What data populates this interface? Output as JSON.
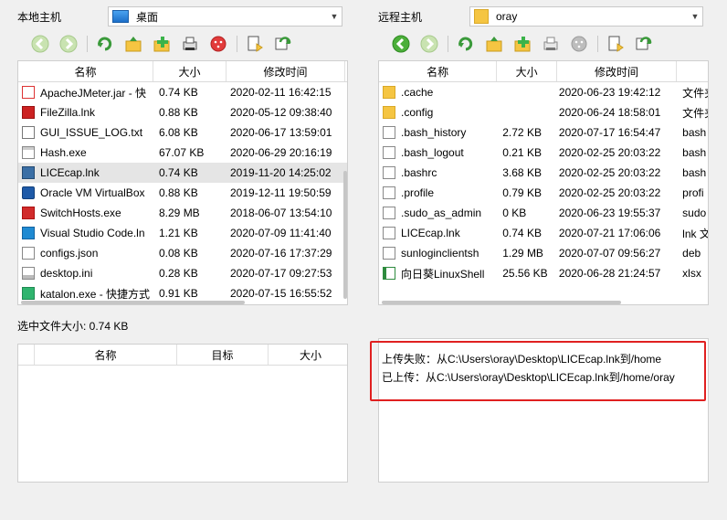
{
  "local": {
    "title": "本地主机",
    "path": "桌面",
    "headers": [
      "名称",
      "大小",
      "修改时间"
    ],
    "files": [
      {
        "name": "ApacheJMeter.jar - 快",
        "size": "0.74 KB",
        "time": "2020-02-11 16:42:15",
        "icon": "java-icon"
      },
      {
        "name": "FileZilla.lnk",
        "size": "0.88 KB",
        "time": "2020-05-12 09:38:40",
        "icon": "filezilla-icon"
      },
      {
        "name": "GUI_ISSUE_LOG.txt",
        "size": "6.08 KB",
        "time": "2020-06-17 13:59:01",
        "icon": "text-file-icon"
      },
      {
        "name": "Hash.exe",
        "size": "67.07 KB",
        "time": "2020-06-29 20:16:19",
        "icon": "exe-icon"
      },
      {
        "name": "LICEcap.lnk",
        "size": "0.74 KB",
        "time": "2019-11-20 14:25:02",
        "icon": "licecap-icon"
      },
      {
        "name": "Oracle VM VirtualBox",
        "size": "0.88 KB",
        "time": "2019-12-11 19:50:59",
        "icon": "virtualbox-icon"
      },
      {
        "name": "SwitchHosts.exe",
        "size": "8.29 MB",
        "time": "2018-06-07 13:54:10",
        "icon": "switchhosts-icon"
      },
      {
        "name": "Visual Studio Code.ln",
        "size": "1.21 KB",
        "time": "2020-07-09 11:41:40",
        "icon": "vscode-icon"
      },
      {
        "name": "configs.json",
        "size": "0.08 KB",
        "time": "2020-07-16 17:37:29",
        "icon": "file-icon"
      },
      {
        "name": "desktop.ini",
        "size": "0.28 KB",
        "time": "2020-07-17 09:27:53",
        "icon": "ini-file-icon"
      },
      {
        "name": "katalon.exe - 快捷方式",
        "size": "0.91 KB",
        "time": "2020-07-15 16:55:52",
        "icon": "katalon-icon"
      }
    ],
    "selected_size": "选中文件大小: 0.74 KB"
  },
  "remote": {
    "title": "远程主机",
    "path": "oray",
    "headers": [
      "名称",
      "大小",
      "修改时间",
      ""
    ],
    "files": [
      {
        "name": ".cache",
        "size": "",
        "time": "2020-06-23 19:42:12",
        "type": "文件夹",
        "icon": "folder-icon"
      },
      {
        "name": ".config",
        "size": "",
        "time": "2020-06-24 18:58:01",
        "type": "文件夹",
        "icon": "folder-icon"
      },
      {
        "name": ".bash_history",
        "size": "2.72 KB",
        "time": "2020-07-17 16:54:47",
        "type": "bash",
        "icon": "file-icon"
      },
      {
        "name": ".bash_logout",
        "size": "0.21 KB",
        "time": "2020-02-25 20:03:22",
        "type": "bash",
        "icon": "file-icon"
      },
      {
        "name": ".bashrc",
        "size": "3.68 KB",
        "time": "2020-02-25 20:03:22",
        "type": "bash",
        "icon": "file-icon"
      },
      {
        "name": ".profile",
        "size": "0.79 KB",
        "time": "2020-02-25 20:03:22",
        "type": "profi",
        "icon": "file-icon"
      },
      {
        "name": ".sudo_as_admin",
        "size": "0 KB",
        "time": "2020-06-23 19:55:37",
        "type": "sudo",
        "icon": "file-icon"
      },
      {
        "name": "LICEcap.lnk",
        "size": "0.74 KB",
        "time": "2020-07-21 17:06:06",
        "type": "lnk 文",
        "icon": "file-icon"
      },
      {
        "name": "sunloginclientsh",
        "size": "1.29 MB",
        "time": "2020-07-07 09:56:27",
        "type": "deb",
        "icon": "file-icon"
      },
      {
        "name": "向日葵LinuxShell",
        "size": "25.56 KB",
        "time": "2020-06-28 21:24:57",
        "type": "xlsx",
        "icon": "excel-icon"
      }
    ]
  },
  "transfer": {
    "headers": [
      "名称",
      "目标",
      "大小"
    ]
  },
  "log": {
    "lines": [
      "上传失败：从C:\\Users\\oray\\Desktop\\LICEcap.lnk到/home",
      "已上传：从C:\\Users\\oray\\Desktop\\LICEcap.lnk到/home/oray"
    ],
    "highlight_color": "#e02020"
  }
}
